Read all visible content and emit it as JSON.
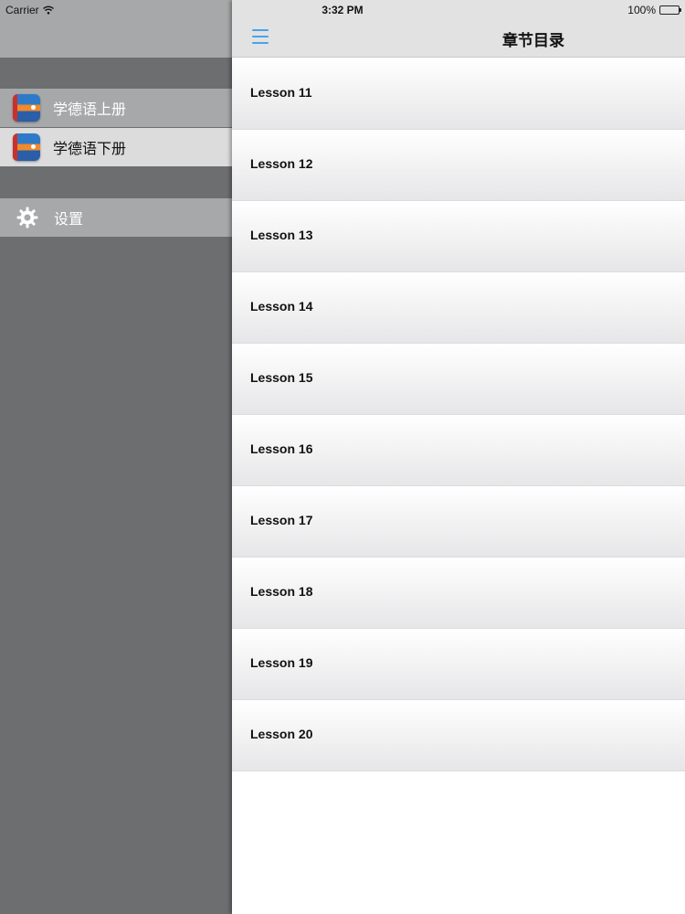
{
  "status_bar": {
    "carrier": "Carrier",
    "time": "3:32 PM",
    "battery": "100%"
  },
  "sidebar": {
    "items": [
      {
        "label": "学德语上册",
        "icon": "book-icon"
      },
      {
        "label": "学德语下册",
        "icon": "book-icon"
      }
    ],
    "settings": {
      "label": "设置",
      "icon": "gear-icon"
    }
  },
  "nav": {
    "title": "章节目录",
    "menu_icon": "hamburger-menu-icon",
    "accent_color": "#4aa3e6"
  },
  "lessons": [
    "Lesson 11",
    "Lesson 12",
    "Lesson 13",
    "Lesson 14",
    "Lesson 15",
    "Lesson 16",
    "Lesson 17",
    "Lesson 18",
    "Lesson 19",
    "Lesson 20"
  ]
}
